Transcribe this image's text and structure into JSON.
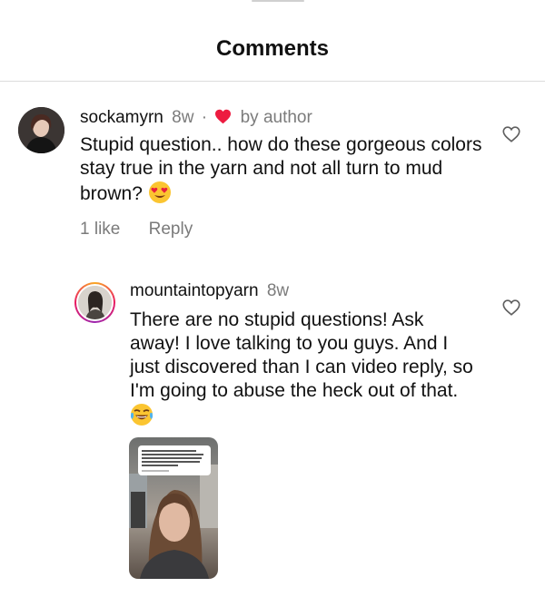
{
  "header": {
    "title": "Comments"
  },
  "comments": [
    {
      "username": "sockamyrn",
      "time": "8w",
      "separator": "·",
      "badge": "by author",
      "text": "Stupid question.. how do these gorgeous colors stay true in the yarn and not all turn to mud brown?",
      "emoji": "heart-eyes-emoji",
      "likes": "1 like",
      "reply": "Reply"
    },
    {
      "username": "mountaintopyarn",
      "time": "8w",
      "text": "There are no stupid questions! Ask away! I love talking to you guys. And I just discovered than I can video reply, so I'm going to abuse the heck out of that.",
      "emoji": "laughing-tears-emoji"
    }
  ],
  "colors": {
    "heart": "#ed1c40",
    "muted": "#7b7b7b",
    "divider": "#dcdcdc"
  }
}
